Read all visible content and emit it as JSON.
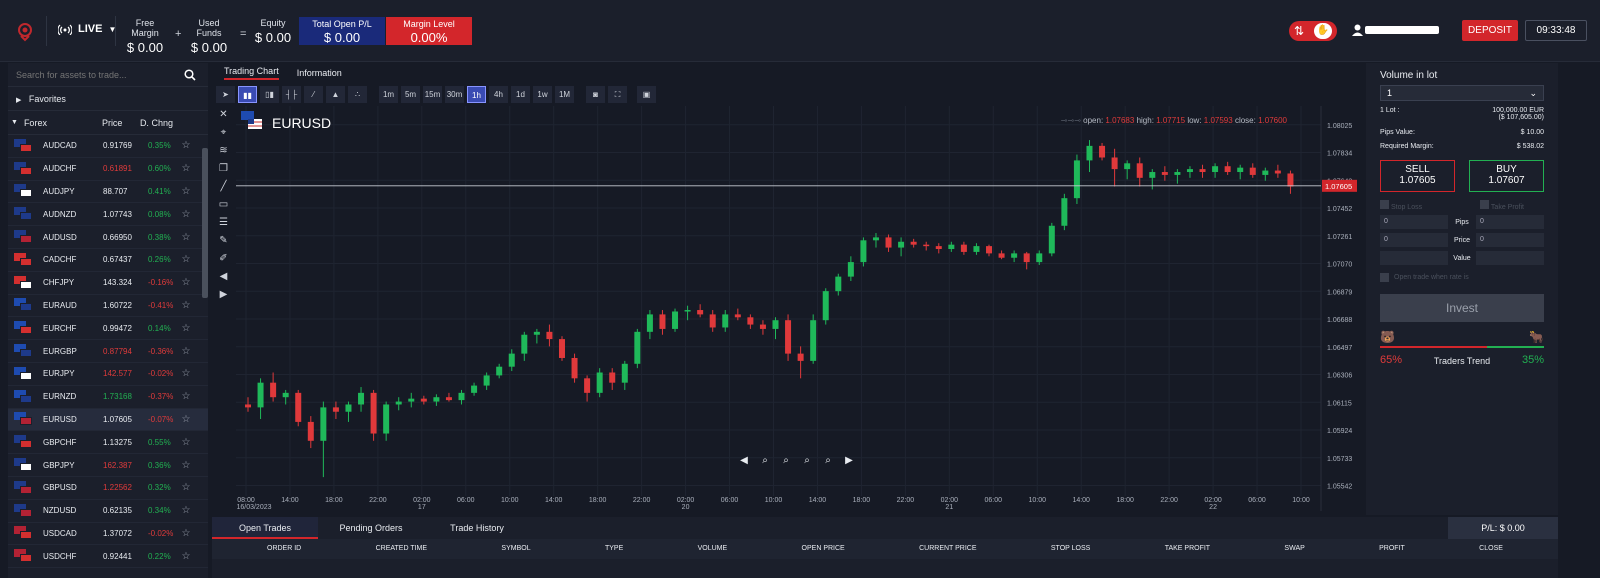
{
  "header": {
    "live_label": "LIVE",
    "free_margin_label": "Free Margin",
    "free_margin_value": "$ 0.00",
    "used_funds_label": "Used Funds",
    "used_funds_value": "$ 0.00",
    "equity_label": "Equity",
    "equity_value": "$ 0.00",
    "plus_sign": "+",
    "equals_sign": "=",
    "total_pl_label": "Total Open P/L",
    "total_pl_value": "$ 0.00",
    "margin_level_label": "Margin Level",
    "margin_level_value": "0.00%",
    "deposit_label": "DEPOSIT",
    "clock": "09:33:48",
    "colors": {
      "brand_red": "#d3262b",
      "blue_box": "#1a2a7a"
    }
  },
  "sidebar": {
    "search_placeholder": "Search for assets to trade...",
    "favorites_label": "Favorites",
    "forex_label": "Forex",
    "price_header": "Price",
    "change_header": "D. Chng",
    "rows": [
      {
        "symbol": "AUDCAD",
        "price": "0.91769",
        "change": "0.35%",
        "pd": "w",
        "cd": "pos"
      },
      {
        "symbol": "AUDCHF",
        "price": "0.61891",
        "change": "0.60%",
        "pd": "neg",
        "cd": "pos"
      },
      {
        "symbol": "AUDJPY",
        "price": "88.707",
        "change": "0.41%",
        "pd": "w",
        "cd": "pos"
      },
      {
        "symbol": "AUDNZD",
        "price": "1.07743",
        "change": "0.08%",
        "pd": "w",
        "cd": "pos"
      },
      {
        "symbol": "AUDUSD",
        "price": "0.66950",
        "change": "0.38%",
        "pd": "w",
        "cd": "pos"
      },
      {
        "symbol": "CADCHF",
        "price": "0.67437",
        "change": "0.26%",
        "pd": "w",
        "cd": "pos"
      },
      {
        "symbol": "CHFJPY",
        "price": "143.324",
        "change": "-0.16%",
        "pd": "w",
        "cd": "neg"
      },
      {
        "symbol": "EURAUD",
        "price": "1.60722",
        "change": "-0.41%",
        "pd": "w",
        "cd": "neg"
      },
      {
        "symbol": "EURCHF",
        "price": "0.99472",
        "change": "0.14%",
        "pd": "w",
        "cd": "pos"
      },
      {
        "symbol": "EURGBP",
        "price": "0.87794",
        "change": "-0.36%",
        "pd": "neg",
        "cd": "neg"
      },
      {
        "symbol": "EURJPY",
        "price": "142.577",
        "change": "-0.02%",
        "pd": "neg",
        "cd": "neg"
      },
      {
        "symbol": "EURNZD",
        "price": "1.73168",
        "change": "-0.37%",
        "pd": "pos",
        "cd": "neg"
      },
      {
        "symbol": "EURUSD",
        "price": "1.07605",
        "change": "-0.07%",
        "pd": "w",
        "cd": "neg"
      },
      {
        "symbol": "GBPCHF",
        "price": "1.13275",
        "change": "0.55%",
        "pd": "w",
        "cd": "pos"
      },
      {
        "symbol": "GBPJPY",
        "price": "162.387",
        "change": "0.36%",
        "pd": "neg",
        "cd": "pos"
      },
      {
        "symbol": "GBPUSD",
        "price": "1.22562",
        "change": "0.32%",
        "pd": "neg",
        "cd": "pos"
      },
      {
        "symbol": "NZDUSD",
        "price": "0.62135",
        "change": "0.34%",
        "pd": "w",
        "cd": "pos"
      },
      {
        "symbol": "USDCAD",
        "price": "1.37072",
        "change": "-0.02%",
        "pd": "w",
        "cd": "neg"
      },
      {
        "symbol": "USDCHF",
        "price": "0.92441",
        "change": "0.22%",
        "pd": "w",
        "cd": "pos"
      }
    ]
  },
  "chart_tabs": {
    "trading_chart": "Trading Chart",
    "information": "Information"
  },
  "timeframes": [
    "1m",
    "5m",
    "15m",
    "30m",
    "1h",
    "4h",
    "1d",
    "1w",
    "1M"
  ],
  "chart_header": {
    "symbol": "EURUSD",
    "open_label": "open:",
    "open": "1.07683",
    "high_label": "high:",
    "high": "1.07715",
    "low_label": "low:",
    "low": "1.07593",
    "close_label": "close:",
    "close": "1.07600"
  },
  "chart_data": {
    "type": "candlestick",
    "symbol": "EURUSD",
    "current_price": "1.07605",
    "y_ticks": [
      "1.08025",
      "1.07834",
      "1.07643",
      "1.07452",
      "1.07261",
      "1.07070",
      "1.06879",
      "1.06688",
      "1.06497",
      "1.06306",
      "1.06115",
      "1.05924",
      "1.05733",
      "1.05542"
    ],
    "x_ticks": [
      {
        "t": "08:00",
        "d": "16/03/2023"
      },
      {
        "t": "14:00",
        "d": ""
      },
      {
        "t": "18:00",
        "d": ""
      },
      {
        "t": "22:00",
        "d": ""
      },
      {
        "t": "02:00",
        "d": "17"
      },
      {
        "t": "06:00",
        "d": ""
      },
      {
        "t": "10:00",
        "d": ""
      },
      {
        "t": "14:00",
        "d": ""
      },
      {
        "t": "18:00",
        "d": ""
      },
      {
        "t": "22:00",
        "d": ""
      },
      {
        "t": "02:00",
        "d": "20"
      },
      {
        "t": "06:00",
        "d": ""
      },
      {
        "t": "10:00",
        "d": ""
      },
      {
        "t": "14:00",
        "d": ""
      },
      {
        "t": "18:00",
        "d": ""
      },
      {
        "t": "22:00",
        "d": ""
      },
      {
        "t": "02:00",
        "d": "21"
      },
      {
        "t": "06:00",
        "d": ""
      },
      {
        "t": "10:00",
        "d": ""
      },
      {
        "t": "14:00",
        "d": ""
      },
      {
        "t": "18:00",
        "d": ""
      },
      {
        "t": "22:00",
        "d": ""
      },
      {
        "t": "02:00",
        "d": "22"
      },
      {
        "t": "06:00",
        "d": ""
      },
      {
        "t": "10:00",
        "d": ""
      }
    ],
    "candles": [
      [
        1.061,
        1.0615,
        1.0605,
        1.0608
      ],
      [
        1.0608,
        1.0628,
        1.06,
        1.0625
      ],
      [
        1.0625,
        1.0632,
        1.0612,
        1.0615
      ],
      [
        1.0615,
        1.062,
        1.061,
        1.0618
      ],
      [
        1.0618,
        1.062,
        1.0595,
        1.0598
      ],
      [
        1.0598,
        1.0602,
        1.058,
        1.0585
      ],
      [
        1.0585,
        1.0612,
        1.056,
        1.0608
      ],
      [
        1.0608,
        1.0612,
        1.06,
        1.0605
      ],
      [
        1.0605,
        1.0612,
        1.0598,
        1.061
      ],
      [
        1.061,
        1.0622,
        1.0605,
        1.0618
      ],
      [
        1.0618,
        1.062,
        1.0585,
        1.059
      ],
      [
        1.059,
        1.0612,
        1.0585,
        1.061
      ],
      [
        1.061,
        1.0615,
        1.0606,
        1.0612
      ],
      [
        1.0612,
        1.0618,
        1.0608,
        1.0614
      ],
      [
        1.0614,
        1.0616,
        1.061,
        1.0612
      ],
      [
        1.0612,
        1.0617,
        1.0609,
        1.0615
      ],
      [
        1.0615,
        1.0618,
        1.0612,
        1.0613
      ],
      [
        1.0613,
        1.062,
        1.061,
        1.0618
      ],
      [
        1.0618,
        1.0625,
        1.0616,
        1.0623
      ],
      [
        1.0623,
        1.0632,
        1.062,
        1.063
      ],
      [
        1.063,
        1.0638,
        1.0628,
        1.0636
      ],
      [
        1.0636,
        1.0648,
        1.0633,
        1.0645
      ],
      [
        1.0645,
        1.066,
        1.064,
        1.0658
      ],
      [
        1.0658,
        1.0662,
        1.0652,
        1.066
      ],
      [
        1.066,
        1.0665,
        1.065,
        1.0655
      ],
      [
        1.0655,
        1.0657,
        1.064,
        1.0642
      ],
      [
        1.0642,
        1.0645,
        1.0625,
        1.0628
      ],
      [
        1.0628,
        1.063,
        1.0612,
        1.0618
      ],
      [
        1.0618,
        1.0635,
        1.0615,
        1.0632
      ],
      [
        1.0632,
        1.0635,
        1.062,
        1.0625
      ],
      [
        1.0625,
        1.064,
        1.062,
        1.0638
      ],
      [
        1.0638,
        1.0662,
        1.0635,
        1.066
      ],
      [
        1.066,
        1.0675,
        1.0655,
        1.0672
      ],
      [
        1.0672,
        1.0675,
        1.0658,
        1.0662
      ],
      [
        1.0662,
        1.0676,
        1.066,
        1.0674
      ],
      [
        1.0674,
        1.0678,
        1.0668,
        1.0675
      ],
      [
        1.0675,
        1.0679,
        1.067,
        1.0672
      ],
      [
        1.0672,
        1.0675,
        1.066,
        1.0663
      ],
      [
        1.0663,
        1.0675,
        1.066,
        1.0672
      ],
      [
        1.0672,
        1.0676,
        1.0668,
        1.067
      ],
      [
        1.067,
        1.0672,
        1.0662,
        1.0665
      ],
      [
        1.0665,
        1.0668,
        1.0658,
        1.0662
      ],
      [
        1.0662,
        1.067,
        1.0655,
        1.0668
      ],
      [
        1.0668,
        1.0672,
        1.064,
        1.0645
      ],
      [
        1.0645,
        1.065,
        1.0628,
        1.064
      ],
      [
        1.064,
        1.0672,
        1.0638,
        1.0668
      ],
      [
        1.0668,
        1.069,
        1.0665,
        1.0688
      ],
      [
        1.0688,
        1.07,
        1.0685,
        1.0698
      ],
      [
        1.0698,
        1.0712,
        1.0695,
        1.0708
      ],
      [
        1.0708,
        1.0725,
        1.0705,
        1.0723
      ],
      [
        1.0723,
        1.0728,
        1.0718,
        1.0725
      ],
      [
        1.0725,
        1.0727,
        1.0715,
        1.0718
      ],
      [
        1.0718,
        1.0725,
        1.0712,
        1.0722
      ],
      [
        1.0722,
        1.0724,
        1.0718,
        1.072
      ],
      [
        1.072,
        1.0722,
        1.0716,
        1.0719
      ],
      [
        1.0719,
        1.0721,
        1.0714,
        1.0717
      ],
      [
        1.0717,
        1.0722,
        1.0715,
        1.072
      ],
      [
        1.072,
        1.0722,
        1.0713,
        1.0715
      ],
      [
        1.0715,
        1.0721,
        1.0713,
        1.0719
      ],
      [
        1.0719,
        1.072,
        1.0712,
        1.0714
      ],
      [
        1.0714,
        1.0716,
        1.071,
        1.0711
      ],
      [
        1.0711,
        1.0716,
        1.0708,
        1.0714
      ],
      [
        1.0714,
        1.0715,
        1.0703,
        1.0708
      ],
      [
        1.0708,
        1.0716,
        1.0706,
        1.0714
      ],
      [
        1.0714,
        1.0735,
        1.0712,
        1.0733
      ],
      [
        1.0733,
        1.0755,
        1.073,
        1.0752
      ],
      [
        1.0752,
        1.0782,
        1.0748,
        1.0778
      ],
      [
        1.0778,
        1.0792,
        1.077,
        1.0788
      ],
      [
        1.0788,
        1.079,
        1.0778,
        1.078
      ],
      [
        1.078,
        1.0786,
        1.076,
        1.0772
      ],
      [
        1.0772,
        1.0778,
        1.0765,
        1.0776
      ],
      [
        1.0776,
        1.078,
        1.076,
        1.0766
      ],
      [
        1.0766,
        1.0772,
        1.0758,
        1.077
      ],
      [
        1.077,
        1.0774,
        1.0764,
        1.0768
      ],
      [
        1.0768,
        1.0772,
        1.0762,
        1.077
      ],
      [
        1.077,
        1.0774,
        1.0766,
        1.0772
      ],
      [
        1.0772,
        1.0775,
        1.0766,
        1.077
      ],
      [
        1.077,
        1.0776,
        1.0766,
        1.0774
      ],
      [
        1.0774,
        1.0777,
        1.0768,
        1.077
      ],
      [
        1.077,
        1.0775,
        1.0765,
        1.0773
      ],
      [
        1.0773,
        1.0776,
        1.0766,
        1.0768
      ],
      [
        1.0768,
        1.0773,
        1.0764,
        1.0771
      ],
      [
        1.0771,
        1.0775,
        1.0766,
        1.0769
      ],
      [
        1.0769,
        1.0771,
        1.0755,
        1.076
      ]
    ]
  },
  "bottom": {
    "tabs": [
      "Open Trades",
      "Pending Orders",
      "Trade History"
    ],
    "pl_label": "P/L: $ 0.00",
    "columns": [
      "ORDER ID",
      "CREATED TIME",
      "SYMBOL",
      "TYPE",
      "VOLUME",
      "OPEN PRICE",
      "CURRENT PRICE",
      "STOP LOSS",
      "TAKE PROFIT",
      "SWAP",
      "PROFIT",
      "CLOSE"
    ]
  },
  "trade_panel": {
    "volume_label": "Volume in lot",
    "volume_value": "1",
    "lot_label": "1 Lot :",
    "lot_value": "100,000.00 EUR",
    "lot_value2": "($ 107,605.00)",
    "pips_value_label": "Pips Value:",
    "pips_value": "$ 10.00",
    "required_margin_label": "Required Margin:",
    "required_margin": "$ 538.02",
    "sell_label": "SELL",
    "sell_price": "1.07605",
    "buy_label": "BUY",
    "buy_price": "1.07607",
    "stop_loss_label": "Stop Loss",
    "take_profit_label": "Take Profit",
    "pips_label": "Pips",
    "price_label": "Price",
    "value_label": "Value",
    "zero": "0",
    "open_at_price_label": "Open trade when rate is",
    "invest_label": "Invest",
    "bear_pct": "65%",
    "bull_pct": "35%",
    "trend_label": "Traders Trend"
  }
}
